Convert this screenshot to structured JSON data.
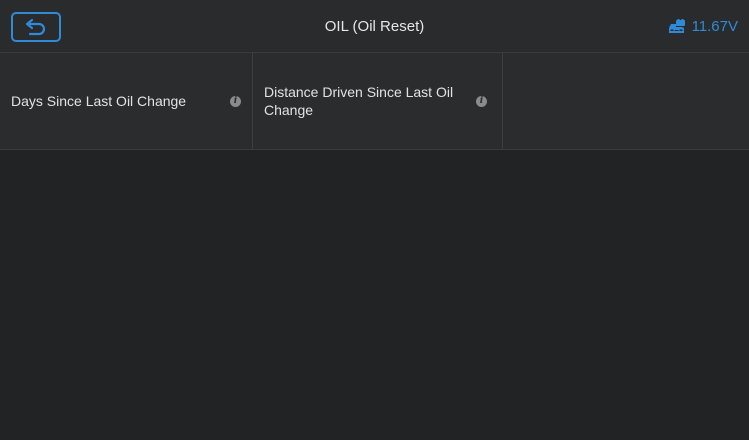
{
  "header": {
    "title": "OIL (Oil Reset)",
    "voltage": "11.67V",
    "back_icon": "back-arrow-icon",
    "battery_icon": "vehicle-battery-icon"
  },
  "columns": [
    {
      "label": "Days Since Last Oil Change",
      "icon": "info-icon"
    },
    {
      "label": "Distance Driven Since Last Oil Change",
      "icon": "info-icon"
    },
    {
      "label": ""
    }
  ],
  "colors": {
    "accent": "#2f8bd8",
    "background": "#222324",
    "header": "#2a2b2d"
  }
}
